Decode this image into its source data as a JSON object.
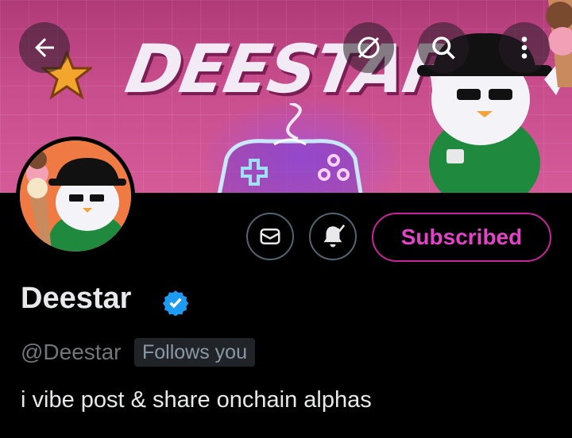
{
  "header": {
    "banner_text": "DEESTAR",
    "back_icon": "arrow-left-icon",
    "translate_icon": "globe-off-icon",
    "search_icon": "search-icon",
    "more_icon": "more-vertical-icon"
  },
  "profile": {
    "display_name": "Deestar",
    "handle": "@Deestar",
    "follows_you": "Follows you",
    "bio": "i vibe post & share onchain alphas",
    "verified_color": "#1d9bf0"
  },
  "actions": {
    "message_icon": "envelope-icon",
    "notify_icon": "bell-check-icon",
    "subscribed_label": "Subscribed",
    "subscribed_color": "#e342c9"
  }
}
